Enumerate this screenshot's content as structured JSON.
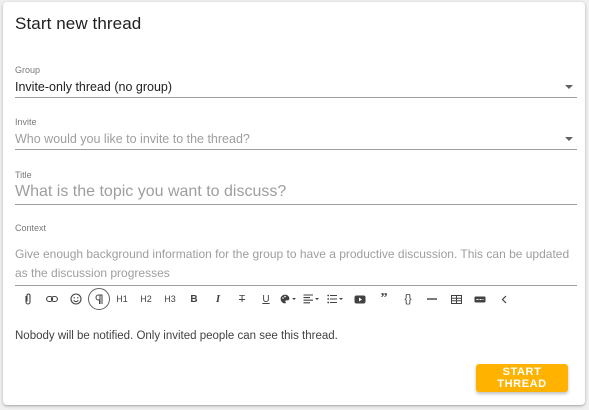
{
  "dialog": {
    "title": "Start new thread"
  },
  "group": {
    "label": "Group",
    "value": "Invite-only thread (no group)"
  },
  "invite": {
    "label": "Invite",
    "placeholder": "Who would you like to invite to the thread?"
  },
  "title_field": {
    "label": "Title",
    "placeholder": "What is the topic you want to discuss?"
  },
  "context": {
    "label": "Context",
    "placeholder": "Give enough background information for the group to have a productive discussion. This can be updated as the discussion progresses"
  },
  "toolbar": {
    "h1": "H1",
    "h2": "H2",
    "h3": "H3",
    "icons": [
      "attachment-icon",
      "link-icon",
      "emoji-icon",
      "paragraph-icon",
      "heading-1",
      "heading-2",
      "heading-3",
      "bold-icon",
      "italic-icon",
      "strikethrough-icon",
      "underline-icon",
      "text-color-icon",
      "align-icon",
      "list-icon",
      "video-icon",
      "quote-icon",
      "code-block-icon",
      "horizontal-rule-icon",
      "table-icon",
      "embed-icon",
      "collapse-icon"
    ]
  },
  "notice": "Nobody will be notified. Only invited people can see this thread.",
  "actions": {
    "start_thread": "START THREAD"
  },
  "colors": {
    "accent": "#ffb300"
  }
}
